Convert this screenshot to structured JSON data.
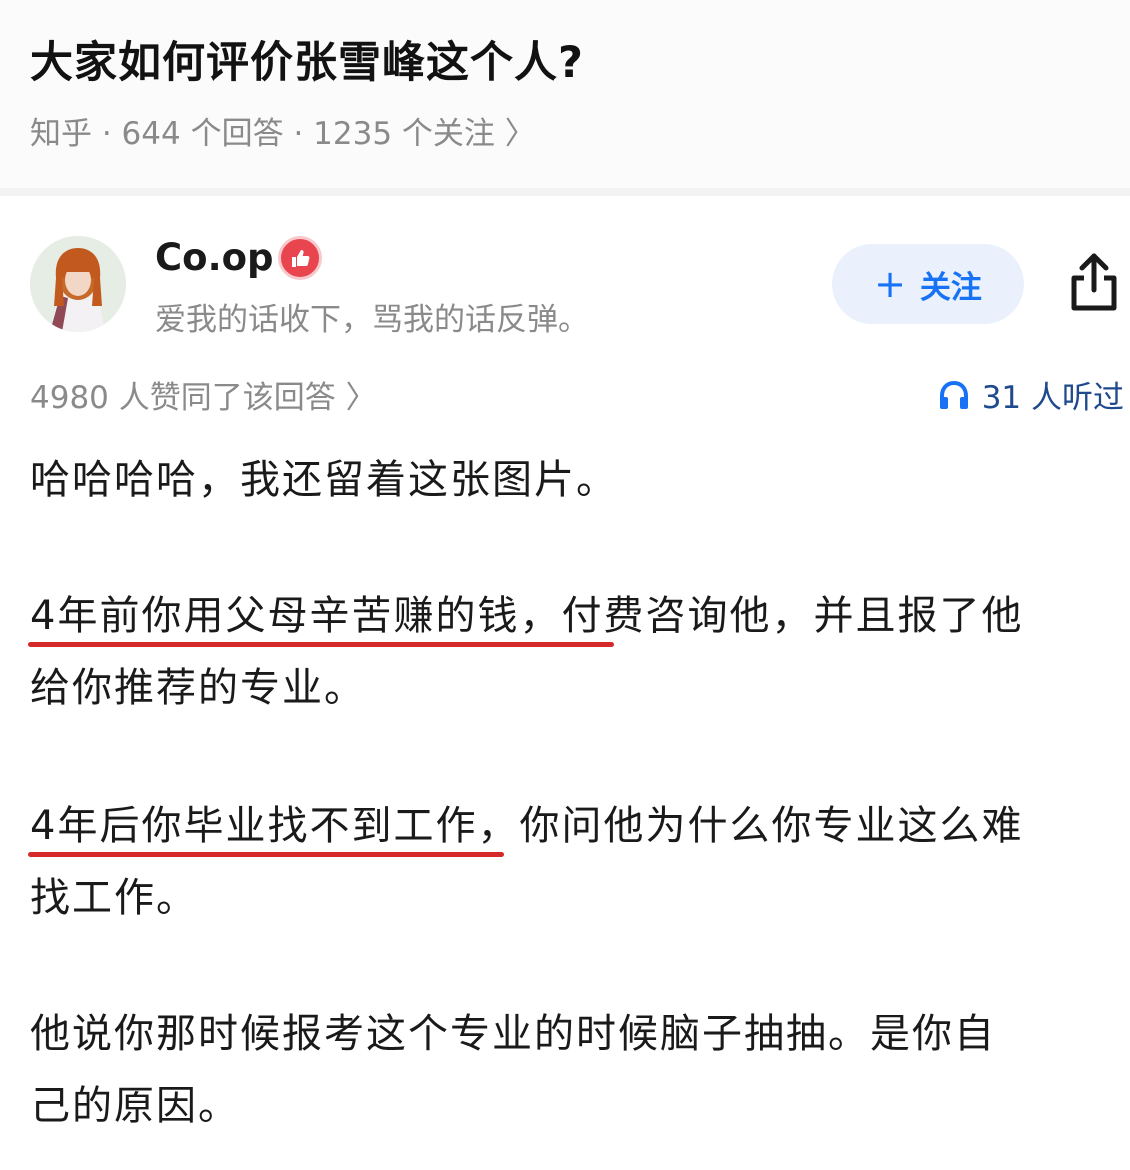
{
  "question": {
    "title": "大家如何评价张雪峰这个人?",
    "meta": "知乎 · 644 个回答 · 1235 个关注 〉"
  },
  "author": {
    "name": "Co.op",
    "bio": "爱我的话收下，骂我的话反弹。",
    "follow_label": "关注",
    "follow_icon": "plus-icon",
    "share_icon": "share-icon",
    "badge_icon": "thumbs-up-badge-icon"
  },
  "stats": {
    "voters": "4980 人赞同了该回答 〉",
    "listened": "31 人听过",
    "listened_icon": "headphones-icon"
  },
  "answer": {
    "p1": "哈哈哈哈，我还留着这张图片。",
    "p2_line1": "4年前你用父母辛苦赚的钱，付费咨询他，并且报了他",
    "p2_line2": "给你推荐的专业。",
    "p3_line1": "4年后你毕业找不到工作，你问他为什么你专业这么难",
    "p3_line2": "找工作。",
    "p4_line1": "他说你那时候报考这个专业的时候脑子抽抽。是你自",
    "p4_line2": "己的原因。"
  },
  "colors": {
    "accent": "#1772f6",
    "underline": "#d42a2a",
    "badge": "#e8454f",
    "muted": "#8a8a8a"
  }
}
